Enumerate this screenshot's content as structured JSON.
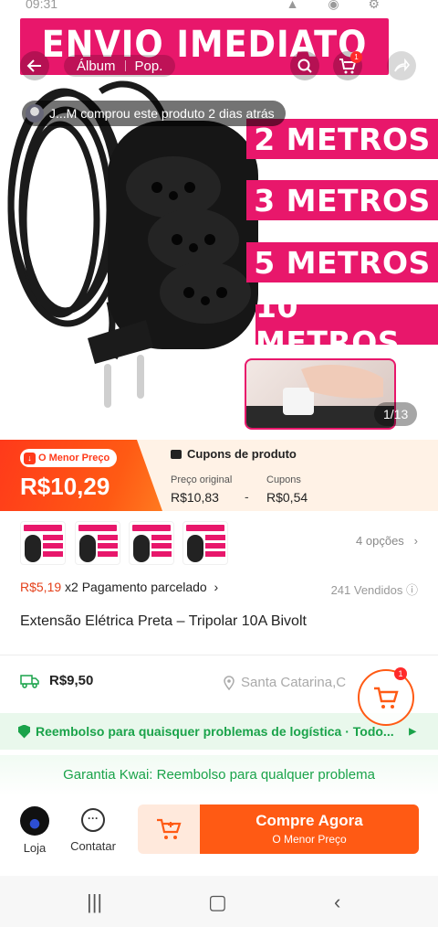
{
  "status_bar": {
    "time": "09:31",
    "icons": "▲ ◉ ⚙"
  },
  "hero": {
    "banner_text": "ENVIO IMEDIATO",
    "tabs": [
      "Álbum",
      "Pop."
    ],
    "cart_badge": "1",
    "buyer_notice": "J...M comprou este produto 2 dias atrás",
    "lengths": [
      "2 METROS",
      "3 METROS",
      "5 METROS",
      "10 METROS"
    ],
    "image_counter": "1/13"
  },
  "price": {
    "lowest_badge": "O Menor Preço",
    "current": "R$10,29",
    "coupons_title": "Cupons de produto",
    "original_label": "Preço original",
    "original_value": "R$10,83",
    "coupon_label": "Cupons",
    "coupon_value": "R$0,54",
    "minus": "-"
  },
  "variants": {
    "thumb_banner": "ENVIO IMEDIATO",
    "count_label": "4 opções"
  },
  "installment": {
    "amount": "R$5,19",
    "text": "x2 Pagamento parcelado"
  },
  "sold": "241 Vendidos",
  "product_title": "Extensão Elétrica Preta – Tripolar 10A Bivolt",
  "shipping": {
    "price": "R$9,50",
    "location": "Santa Catarina,C"
  },
  "floating_cart_badge": "1",
  "refund_text": "Reembolso para quaisquer problemas de logística · Todo...",
  "guarantee_text": "Garantia Kwai: Reembolso para qualquer problema",
  "bottom_bar": {
    "store_label": "Loja",
    "contact_label": "Contatar",
    "buy_label": "Compre Agora",
    "buy_sub": "O Menor Preço"
  },
  "colors": {
    "brand_pink": "#e8176b",
    "accent_orange": "#ff5a14",
    "success_green": "#1aa34a"
  }
}
